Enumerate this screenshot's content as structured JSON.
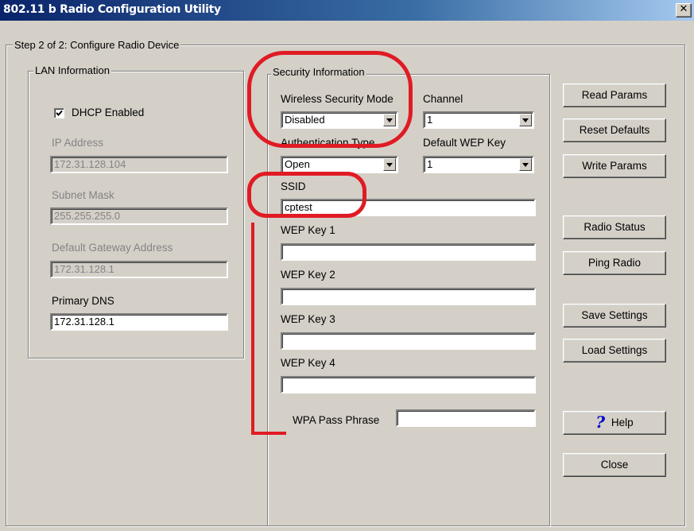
{
  "window": {
    "title": "802.11 b Radio Configuration Utility",
    "close_glyph": "✕"
  },
  "step_group": {
    "label": "Step 2 of 2: Configure Radio Device"
  },
  "lan": {
    "label": "LAN Information",
    "dhcp_label": "DHCP Enabled",
    "dhcp_checked": true,
    "ip_label": "IP Address",
    "ip_value": "172.31.128.104",
    "subnet_label": "Subnet Mask",
    "subnet_value": "255.255.255.0",
    "gateway_label": "Default Gateway Address",
    "gateway_value": "172.31.128.1",
    "dns_label": "Primary DNS",
    "dns_value": "172.31.128.1"
  },
  "security": {
    "label": "Security Information",
    "mode_label": "Wireless Security Mode",
    "mode_value": "Disabled",
    "channel_label": "Channel",
    "channel_value": "1",
    "auth_label": "Authentication Type",
    "auth_value": "Open",
    "wep_default_label": "Default WEP Key",
    "wep_default_value": "1",
    "ssid_label": "SSID",
    "ssid_value": "cptest",
    "wep1_label": "WEP Key 1",
    "wep1_value": "",
    "wep2_label": "WEP Key 2",
    "wep2_value": "",
    "wep3_label": "WEP Key 3",
    "wep3_value": "",
    "wep4_label": "WEP Key 4",
    "wep4_value": "",
    "wpa_label": "WPA Pass Phrase",
    "wpa_value": ""
  },
  "buttons": {
    "read_params": "Read Params",
    "reset_defaults": "Reset Defaults",
    "write_params": "Write Params",
    "radio_status": "Radio Status",
    "ping_radio": "Ping Radio",
    "save_settings": "Save Settings",
    "load_settings": "Load Settings",
    "help": "Help",
    "close": "Close"
  },
  "colors": {
    "titlebar": "#0a246a",
    "annotation": "#e01b24",
    "help_icon": "#0000cc"
  }
}
